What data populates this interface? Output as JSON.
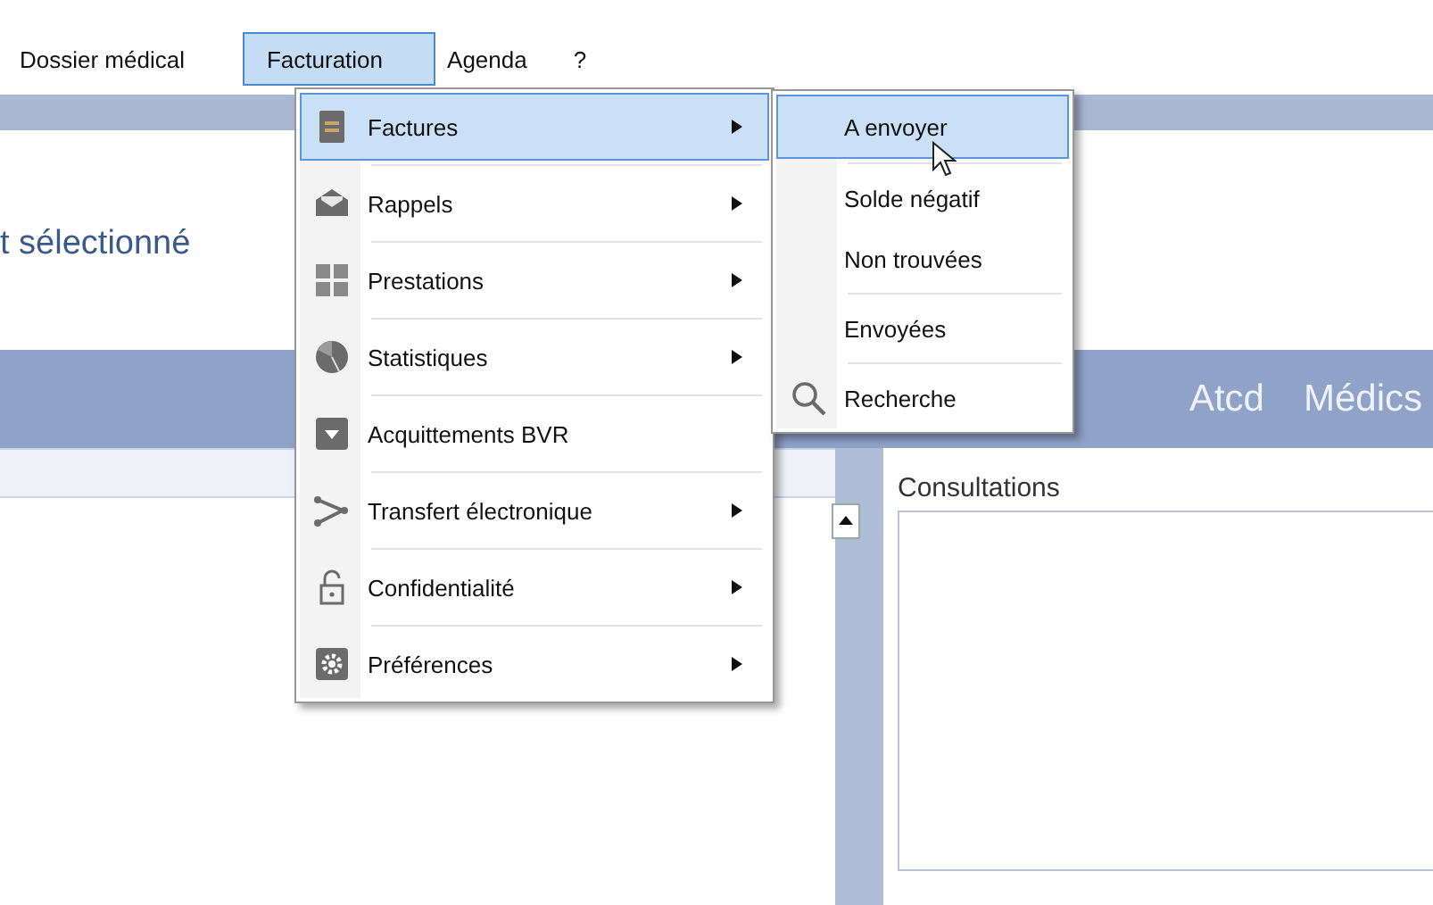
{
  "menu_bar": [
    {
      "label": "Dossier médical",
      "selected": false
    },
    {
      "label": "Facturation",
      "selected": true
    },
    {
      "label": "Agenda",
      "selected": false
    },
    {
      "label": "?",
      "selected": false
    }
  ],
  "header_text": "t sélectionné",
  "tabs": [
    "Atcd",
    "Médics"
  ],
  "right_panel": {
    "title": "Consultations"
  },
  "menu": {
    "items": [
      {
        "label": "Factures",
        "kind": "document",
        "submenu": true,
        "selected": true
      },
      {
        "label": "Rappels",
        "kind": "envelope",
        "submenu": true,
        "selected": false
      },
      {
        "label": "Prestations",
        "kind": "grid",
        "submenu": true,
        "selected": false
      },
      {
        "label": "Statistiques",
        "kind": "pie",
        "submenu": true,
        "selected": false
      },
      {
        "label": "Acquittements BVR",
        "kind": "archive",
        "submenu": false,
        "selected": false
      },
      {
        "label": "Transfert électronique",
        "kind": "branch",
        "submenu": true,
        "selected": false
      },
      {
        "label": "Confidentialité",
        "kind": "lock",
        "submenu": true,
        "selected": false
      },
      {
        "label": "Préférences",
        "kind": "gear",
        "submenu": true,
        "selected": false
      }
    ]
  },
  "submenu": {
    "groups": [
      [
        {
          "label": "A envoyer",
          "selected": true
        }
      ],
      [
        {
          "label": "Solde négatif",
          "selected": false
        },
        {
          "label": "Non trouvées",
          "selected": false
        }
      ],
      [
        {
          "label": "Envoyées",
          "selected": false
        }
      ],
      [
        {
          "label": "Recherche",
          "kind": "search",
          "selected": false
        }
      ]
    ]
  }
}
